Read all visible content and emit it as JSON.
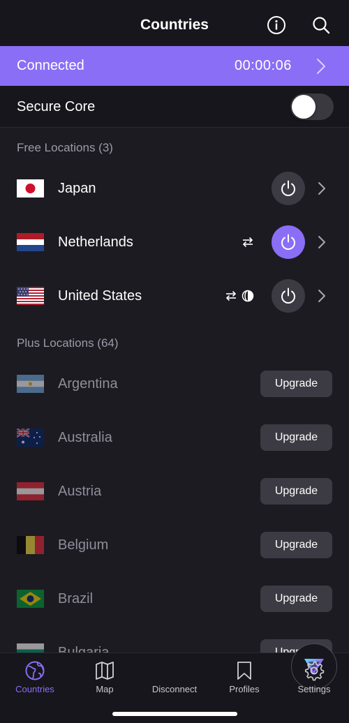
{
  "header": {
    "title": "Countries",
    "info_icon": "info-icon",
    "search_icon": "search-icon"
  },
  "connection": {
    "status": "Connected",
    "timer": "00:00:06"
  },
  "secure_core": {
    "label": "Secure Core",
    "enabled": false
  },
  "free_section": {
    "title": "Free Locations (3)"
  },
  "free_locations": [
    {
      "name": "Japan",
      "connected": false,
      "features": []
    },
    {
      "name": "Netherlands",
      "connected": true,
      "features": [
        "p2p-icon"
      ]
    },
    {
      "name": "United States",
      "connected": false,
      "features": [
        "p2p-icon",
        "tor-icon"
      ]
    }
  ],
  "plus_section": {
    "title": "Plus Locations (64)"
  },
  "plus_locations": [
    {
      "name": "Argentina",
      "button": "Upgrade"
    },
    {
      "name": "Australia",
      "button": "Upgrade"
    },
    {
      "name": "Austria",
      "button": "Upgrade"
    },
    {
      "name": "Belgium",
      "button": "Upgrade"
    },
    {
      "name": "Brazil",
      "button": "Upgrade"
    },
    {
      "name": "Bulgaria",
      "button": "Upgrade"
    }
  ],
  "nav": {
    "countries": "Countries",
    "map": "Map",
    "disconnect": "Disconnect",
    "profiles": "Profiles",
    "settings": "Settings"
  },
  "colors": {
    "accent": "#8a6ef6",
    "background": "#1c1b22",
    "surface": "#17161c",
    "button": "#3c3b43"
  }
}
